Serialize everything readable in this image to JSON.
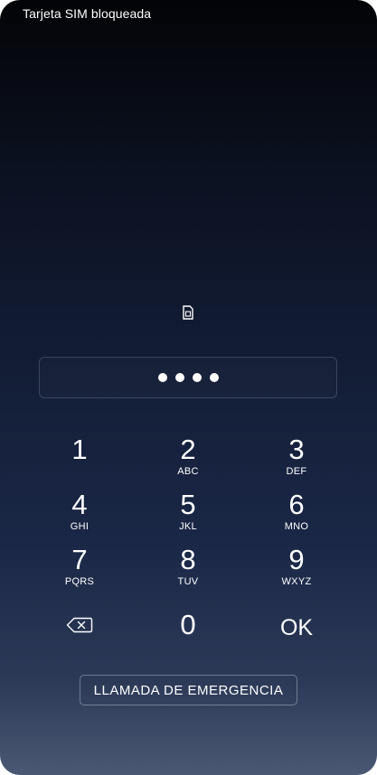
{
  "status_bar": {
    "text": "Tarjeta SIM bloqueada"
  },
  "icons": {
    "sim": "sim-card-icon",
    "backspace": "backspace-icon"
  },
  "pin": {
    "entered_digits": 4
  },
  "keypad": {
    "k1": {
      "num": "1",
      "letters": ""
    },
    "k2": {
      "num": "2",
      "letters": "ABC"
    },
    "k3": {
      "num": "3",
      "letters": "DEF"
    },
    "k4": {
      "num": "4",
      "letters": "GHI"
    },
    "k5": {
      "num": "5",
      "letters": "JKL"
    },
    "k6": {
      "num": "6",
      "letters": "MNO"
    },
    "k7": {
      "num": "7",
      "letters": "PQRS"
    },
    "k8": {
      "num": "8",
      "letters": "TUV"
    },
    "k9": {
      "num": "9",
      "letters": "WXYZ"
    },
    "k0": {
      "num": "0",
      "letters": ""
    },
    "ok": "OK"
  },
  "emergency_button": {
    "label": "LLAMADA DE EMERGENCIA"
  },
  "colors": {
    "background_top": "#030407",
    "background_bottom": "#4a5873",
    "text": "#ffffff"
  }
}
